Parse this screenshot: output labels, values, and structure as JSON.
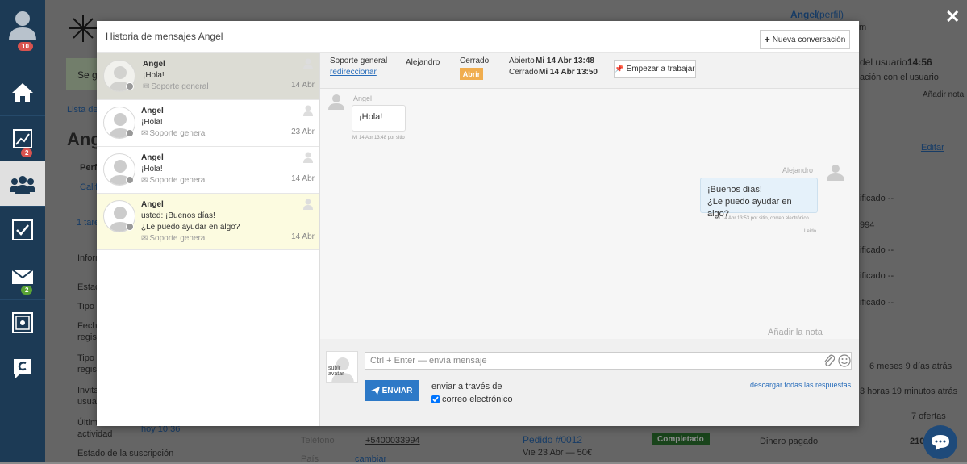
{
  "sidebar": {
    "items": [
      {
        "icon": "user-avatar-icon",
        "badge": "10"
      },
      {
        "icon": "home-icon"
      },
      {
        "icon": "chart-icon",
        "badge": "2"
      },
      {
        "icon": "users-icon",
        "active": true
      },
      {
        "icon": "checkbox-icon"
      },
      {
        "icon": "mail-icon",
        "badge": "2"
      },
      {
        "icon": "safe-icon"
      },
      {
        "icon": "chat-logo-icon"
      }
    ]
  },
  "background": {
    "se_gu": "Se gu",
    "lista_de": "Lista de",
    "ang": "Ang",
    "perf": "Perf",
    "calif": "Calif",
    "tare": "1 tare",
    "inform": "Inform",
    "estad": "Estad",
    "tipo": "Tipo",
    "fech": "Fech",
    "regis": "regis",
    "tipo2": "Tipo",
    "regis2": "regis",
    "invita": "Invita",
    "usua": "usua",
    "ultim": "Últim",
    "actividad": "actividad",
    "hoy": "hoy 10:36",
    "estado_susc": "Estado de la suscripción",
    "telefono_label": "Teléfono",
    "telefono_value": "+5400033994",
    "pais_label": "País",
    "pais_value": "cambiar",
    "pedido": "Pedido #0012",
    "pedido_date": "Vie 23 Abr — 50€",
    "pedido_status": "Completado",
    "rp_name": "Angel",
    "rp_perfil": "(perfil)",
    "rp_m": "m",
    "rp_usuario_label": "del usuario:",
    "rp_usuario_time": "14:56",
    "rp_accion": "ación con el usuario",
    "rp_add_note": "Añadir nota",
    "rp_edit": "Editar",
    "rp_ificado1": "ificado --",
    "rp_994": "994",
    "rp_ificado2": "ificado --",
    "rp_ificado3": "ificado --",
    "rp_ificado4": "ificado --",
    "rp_6meses": "6 meses 9 días atrás",
    "rp_horas": "3 horas 19 minutos atrás",
    "rp_ofertas": "7 ofertas",
    "rp_dinero": "Dinero pagado",
    "rp_210": "210"
  },
  "modal": {
    "title": "Historia de mensajes Angel",
    "new_conversation": "Nueva conversación",
    "conversations": [
      {
        "name": "Angel",
        "line1": "¡Hola!",
        "line2": "",
        "channel": "Soporte general",
        "date": "14 Abr",
        "state": "selected"
      },
      {
        "name": "Angel",
        "line1": "¡Hola!",
        "line2": "",
        "channel": "Soporte general",
        "date": "23 Abr",
        "state": "normal"
      },
      {
        "name": "Angel",
        "line1": "¡Hola!",
        "line2": "",
        "channel": "Soporte general",
        "date": "14 Abr",
        "state": "normal"
      },
      {
        "name": "Angel",
        "line1": "usted: ¡Buenos días!",
        "line2": "¿Le puedo ayudar en algo?",
        "channel": "Soporte general",
        "date": "14 Abr",
        "state": "highlight"
      }
    ],
    "meta": {
      "channel": "Soporte general",
      "redirect": "redireccionar",
      "agent": "Alejandro",
      "status": "Cerrado",
      "reopen": "Abrir",
      "opened_label": "Abierto",
      "opened_value": "Mi 14 Abr 13:48",
      "closed_label": "Cerrado",
      "closed_value": "Mi 14 Abr 13:50",
      "start_work": "Empezar a trabajar"
    },
    "messages": [
      {
        "sender": "Angel",
        "text": "¡Hola!",
        "meta": "Mi 14 Abr 13:48 por sitio"
      },
      {
        "sender": "Alejandro",
        "line1": "¡Buenos días!",
        "line2": "¿Le puedo ayudar en algo?",
        "meta": "Mi 14 Abr 13:53 por sitio, correo electrónico",
        "read": "Leído"
      }
    ],
    "add_note": "Añadir la nota",
    "composer": {
      "upload_avatar": "subir avatar",
      "placeholder": "Ctrl + Enter — envía mensaje",
      "send": "ENVIAR",
      "via": "enviar a través de",
      "email_option": "correo electrónico",
      "download_all": "descargar todas las respuestas"
    }
  }
}
